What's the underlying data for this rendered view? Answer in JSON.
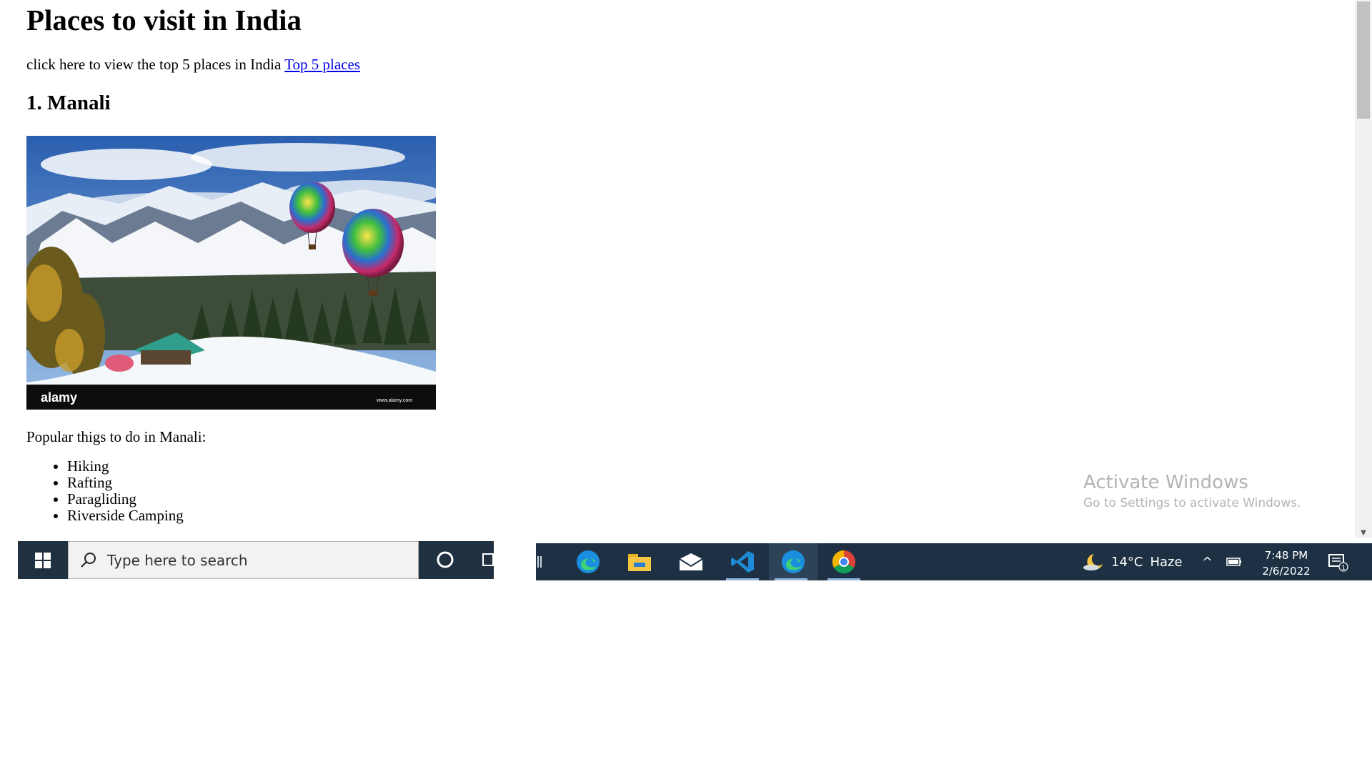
{
  "page": {
    "title": "Places to visit in India",
    "intro_text": "click here to view the top 5 places in India ",
    "intro_link": "Top 5 places",
    "section_heading": "1. Manali",
    "photo_watermark_brand": "alamy",
    "photo_watermark_url": "www.alamy.com",
    "todo_label": "Popular thigs to do in Manali:",
    "todo_items": [
      "Hiking",
      "Rafting",
      "Paragliding",
      "Riverside Camping"
    ]
  },
  "watermark": {
    "title": "Activate Windows",
    "subtitle": "Go to Settings to activate Windows."
  },
  "taskbar": {
    "search_placeholder": "Type here to search",
    "apps": [
      "edge-icon",
      "file-explorer-icon",
      "mail-icon",
      "vscode-icon",
      "edge-icon",
      "chrome-icon"
    ],
    "weather_temp": "14°C",
    "weather_desc": "Haze",
    "time": "7:48 PM",
    "date": "2/6/2022",
    "notification_count": "1"
  }
}
